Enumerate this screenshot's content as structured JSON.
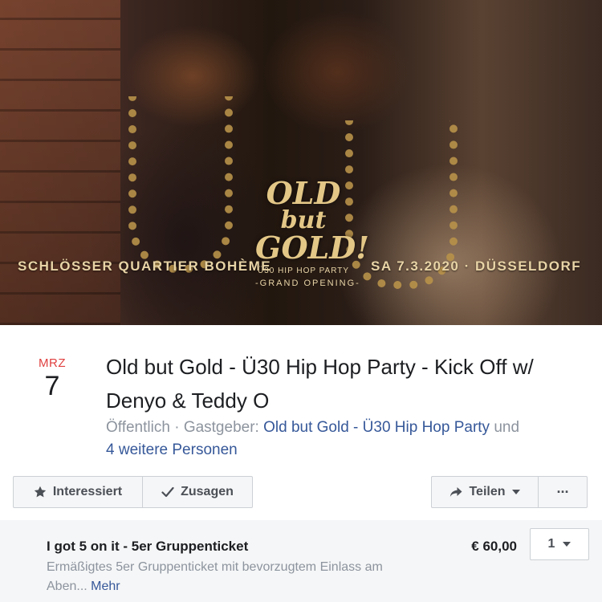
{
  "cover": {
    "left_text": "SCHLÖSSER QUARTIER BOHÈME",
    "right_text": "SA 7.3.2020 · DÜSSELDORF",
    "logo_line1": "OLD",
    "logo_line2": "but",
    "logo_line3": "GOLD!",
    "logo_sub1": "Ü30 HIP HOP PARTY",
    "logo_sub2": "-GRAND OPENING-"
  },
  "event": {
    "month": "MRZ",
    "day": "7",
    "title": "Old but Gold - Ü30 Hip Hop Party - Kick Off w/ Denyo & Teddy O",
    "visibility": "Öffentlich",
    "separator": " · ",
    "host_label": "Gastgeber: ",
    "host_name": "Old but Gold - Ü30 Hip Hop Party",
    "and_text": " und",
    "others": "4 weitere Personen"
  },
  "actions": {
    "interested_label": "Interessiert",
    "going_label": "Zusagen",
    "share_label": "Teilen",
    "more_label": "···"
  },
  "ticket": {
    "name": "I got 5 on it - 5er Gruppenticket",
    "description": "Ermäßigtes 5er Gruppenticket mit bevorzugtem Einlass am Aben...",
    "more_link": "Mehr",
    "price": "€ 60,00",
    "quantity": "1"
  },
  "colors": {
    "date_month": "#e03f3f",
    "link": "#365899",
    "muted_text": "#8d949e",
    "logo_gold": "#e3c787"
  }
}
